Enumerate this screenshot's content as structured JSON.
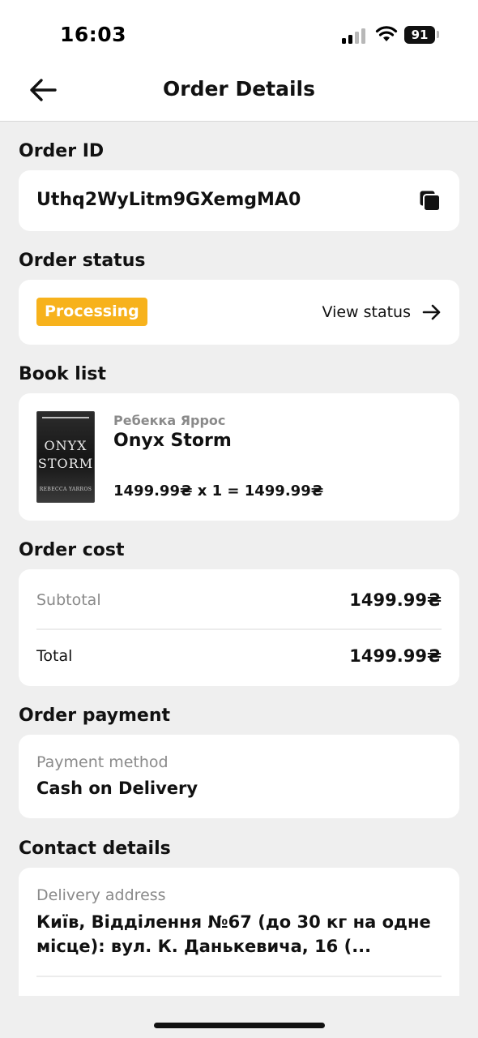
{
  "status_bar": {
    "time": "16:03",
    "battery": "91"
  },
  "header": {
    "title": "Order Details"
  },
  "order_id": {
    "section_title": "Order ID",
    "value": "Uthq2WyLitm9GXemgMA0"
  },
  "order_status": {
    "section_title": "Order status",
    "badge": "Processing",
    "badge_color": "#f7b21c",
    "view_status_label": "View status"
  },
  "book_list": {
    "section_title": "Book list",
    "items": [
      {
        "author": "Ребекка Яррос",
        "title": "Onyx Storm",
        "price_line": "1499.99₴ x 1 = 1499.99₴",
        "cover": {
          "line1": "ONYX",
          "line2": "STORM",
          "author": "REBECCA YARROS"
        }
      }
    ]
  },
  "order_cost": {
    "section_title": "Order cost",
    "subtotal_label": "Subtotal",
    "subtotal_value": "1499.99₴",
    "total_label": "Total",
    "total_value": "1499.99₴"
  },
  "order_payment": {
    "section_title": "Order payment",
    "method_label": "Payment method",
    "method_value": "Cash on Delivery"
  },
  "contact_details": {
    "section_title": "Contact details",
    "address_label": "Delivery address",
    "address_value": "Київ, Відділення №67 (до 30 кг на одне місце): вул. К. Данькевича, 16 (..."
  }
}
